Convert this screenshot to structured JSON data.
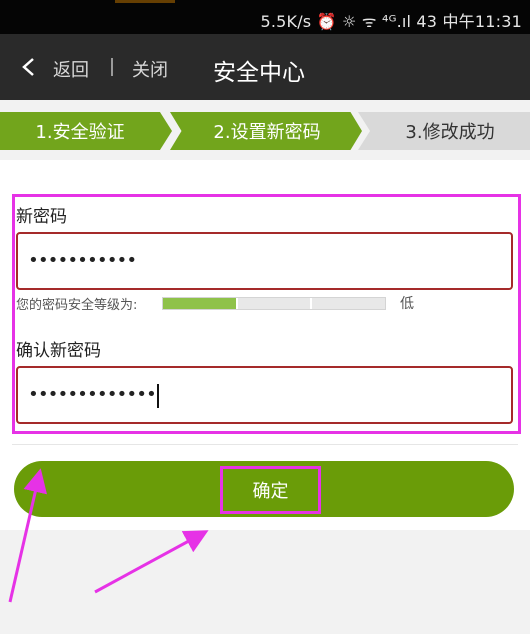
{
  "status_bar": {
    "text": "5.5K/s ⏰ ☼ ᯤ ⁴ᴳ.ıl 43 中午11:31"
  },
  "title_bar": {
    "back_label": "返回",
    "close_label": "关闭",
    "title": "安全中心"
  },
  "steps": [
    {
      "label": "1.安全验证",
      "state": "done"
    },
    {
      "label": "2.设置新密码",
      "state": "active"
    },
    {
      "label": "3.修改成功",
      "state": "pending"
    }
  ],
  "form": {
    "new_password": {
      "label": "新密码",
      "value": "•••••••••••"
    },
    "strength": {
      "label": "您的密码安全等级为:",
      "level": "低",
      "segments_filled": 1,
      "segments_total": 3
    },
    "confirm_password": {
      "label": "确认新密码",
      "value": "•••••••••••••"
    }
  },
  "confirm_button": {
    "label": "确定"
  },
  "colors": {
    "accent_green": "#72a51c",
    "button_green": "#6a9c08",
    "highlight_magenta": "#e632e6",
    "input_border": "#a52a2a",
    "strength_fill": "#8fc24a"
  }
}
